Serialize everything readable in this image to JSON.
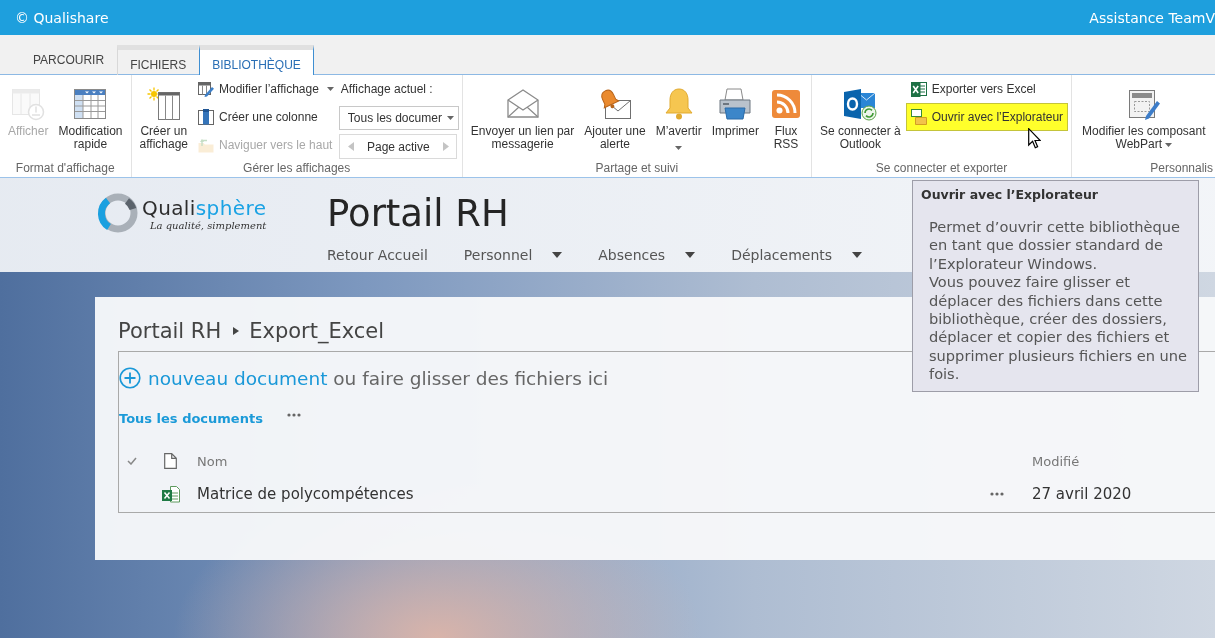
{
  "top_bar": {
    "brand": "© Qualishare",
    "help_link": "Assistance TeamV"
  },
  "ribbon": {
    "tabs": [
      {
        "label": "PARCOURIR",
        "selected": false,
        "contextual": false
      },
      {
        "label": "FICHIERS",
        "selected": false,
        "contextual": true
      },
      {
        "label": "BIBLIOTHÈQUE",
        "selected": true,
        "contextual": true
      }
    ],
    "groups": [
      {
        "label": "Format d'affichage",
        "columns": [
          [
            {
              "kind": "large",
              "label": "Afficher",
              "disabled": true,
              "highlighted": false,
              "menu": false
            }
          ],
          [
            {
              "kind": "large",
              "label": "Modification\nrapide",
              "disabled": false,
              "highlighted": false,
              "menu": false
            }
          ]
        ]
      },
      {
        "label": "Gérer les affichages",
        "columns": [
          [
            {
              "kind": "large",
              "label": "Créer un\naffichage",
              "disabled": false,
              "highlighted": false,
              "menu": false
            }
          ],
          [
            {
              "kind": "small",
              "label": "Modifier l’affichage",
              "disabled": false,
              "highlighted": false,
              "menu": true
            },
            {
              "kind": "small",
              "label": "Créer une colonne",
              "disabled": false,
              "highlighted": false,
              "menu": false
            },
            {
              "kind": "small",
              "label": "Naviguer vers le haut",
              "disabled": true,
              "highlighted": false,
              "menu": false
            }
          ],
          [
            {
              "kind": "label",
              "label": "Affichage actuel :"
            },
            {
              "kind": "dropdown",
              "value": "Tous les documer"
            },
            {
              "kind": "pager",
              "label": "Page active"
            }
          ]
        ]
      },
      {
        "label": "Partage et suivi",
        "columns": [
          [
            {
              "kind": "large",
              "label": "Envoyer un lien par\nmessagerie",
              "disabled": false,
              "highlighted": false,
              "menu": false
            }
          ],
          [
            {
              "kind": "large",
              "label": "Ajouter une\nalerte",
              "disabled": false,
              "highlighted": false,
              "menu": false
            }
          ],
          [
            {
              "kind": "large",
              "label": "M’avertir",
              "disabled": false,
              "highlighted": false,
              "menu": true
            }
          ],
          [
            {
              "kind": "large",
              "label": "Imprimer",
              "disabled": false,
              "highlighted": false,
              "menu": false
            }
          ],
          [
            {
              "kind": "large",
              "label": "Flux\nRSS",
              "disabled": false,
              "highlighted": false,
              "menu": false
            }
          ]
        ]
      },
      {
        "label": "Se connecter et exporter",
        "columns": [
          [
            {
              "kind": "large",
              "label": "Se connecter à\nOutlook",
              "disabled": false,
              "highlighted": false,
              "menu": false
            }
          ],
          [
            {
              "kind": "small",
              "label": "Exporter vers Excel",
              "disabled": false,
              "highlighted": false,
              "menu": false
            },
            {
              "kind": "small",
              "label": "Ouvrir avec l’Explorateur",
              "disabled": false,
              "highlighted": true,
              "menu": false
            }
          ]
        ]
      },
      {
        "label": "Personnalis",
        "columns": [
          [
            {
              "kind": "large",
              "label": "Modifier les composant\nWebPart",
              "disabled": false,
              "highlighted": false,
              "menu": true
            }
          ]
        ]
      }
    ]
  },
  "site_header": {
    "logo_wordmark": [
      "Quali",
      "sphère"
    ],
    "logo_tagline": "La qualité, simplement",
    "title": "Portail RH",
    "nav": [
      {
        "label": "Retour Accueil",
        "menu": false
      },
      {
        "label": "Personnel",
        "menu": true
      },
      {
        "label": "Absences",
        "menu": true
      },
      {
        "label": "Déplacements",
        "menu": true
      }
    ]
  },
  "library": {
    "breadcrumb": [
      "Portail RH",
      "Export_Excel"
    ],
    "upload": {
      "link": "nouveau document",
      "text": "ou faire glisser des fichiers ici"
    },
    "views": [
      {
        "label": "Tous les documents",
        "selected": true
      }
    ],
    "columns": [
      "Nom",
      "Modifié"
    ],
    "rows": [
      {
        "name": "Matrice de polycompétences",
        "modified": "27 avril 2020"
      }
    ]
  },
  "tooltip": {
    "title": "Ouvrir avec l’Explorateur",
    "paragraphs": [
      "Permet d’ouvrir cette bibliothèque en tant que dossier standard de l’Explorateur Windows.",
      "Vous pouvez faire glisser et déplacer des fichiers dans cette bibliothèque, créer des dossiers, déplacer et copier des fichiers et supprimer plusieurs fichiers en une fois."
    ]
  }
}
